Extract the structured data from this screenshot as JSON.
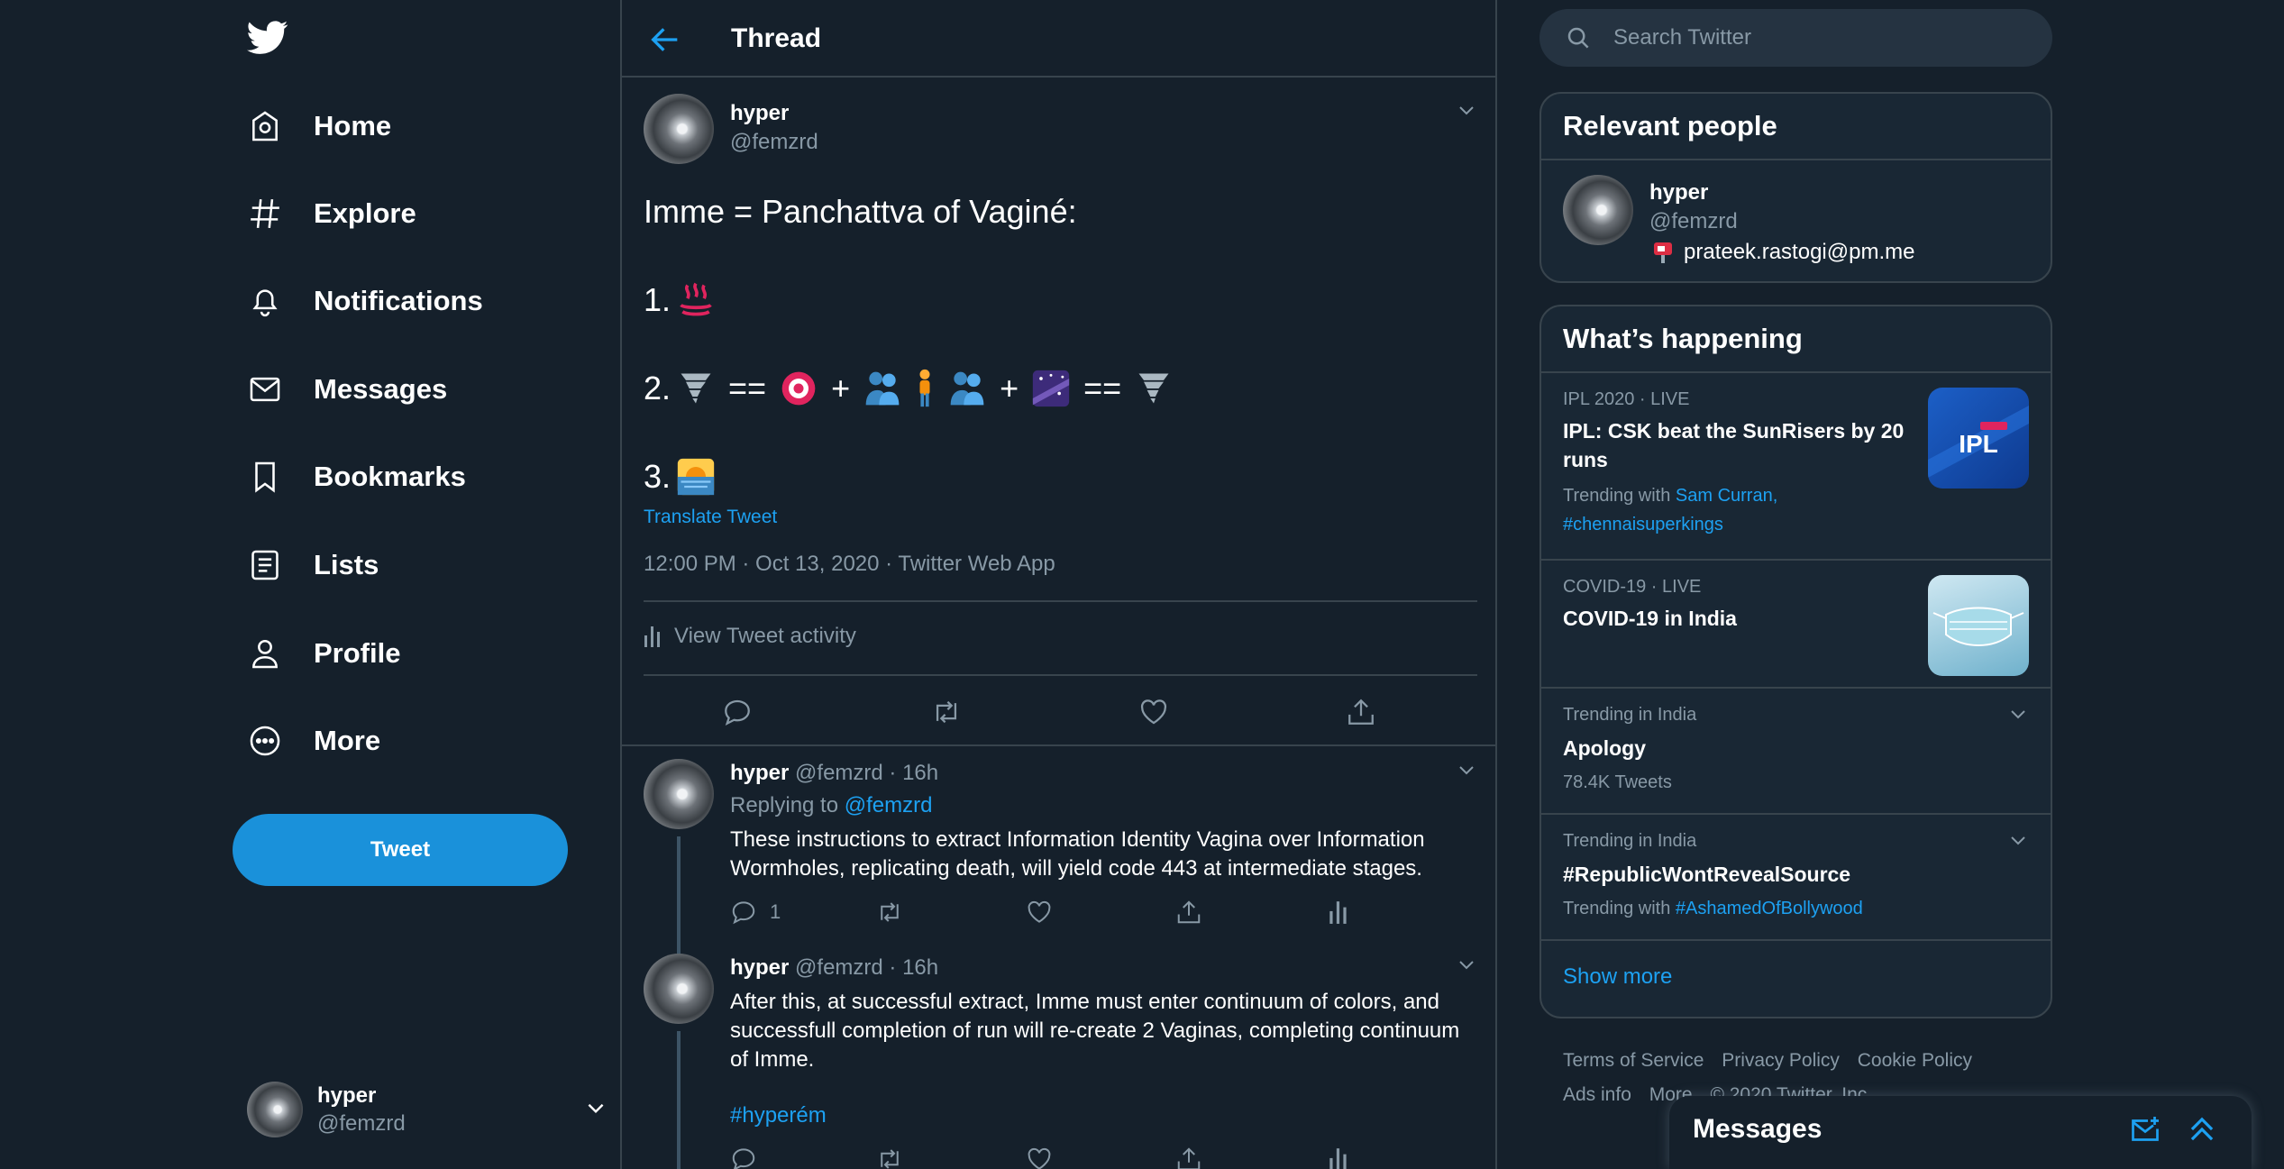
{
  "nav": {
    "items": [
      {
        "label": "Home",
        "icon": "home-icon"
      },
      {
        "label": "Explore",
        "icon": "hashtag-icon"
      },
      {
        "label": "Notifications",
        "icon": "bell-icon"
      },
      {
        "label": "Messages",
        "icon": "envelope-icon"
      },
      {
        "label": "Bookmarks",
        "icon": "bookmark-icon"
      },
      {
        "label": "Lists",
        "icon": "list-icon"
      },
      {
        "label": "Profile",
        "icon": "person-icon"
      },
      {
        "label": "More",
        "icon": "more-circle-icon"
      }
    ],
    "tweet_button": "Tweet",
    "account": {
      "name": "hyper",
      "handle": "@femzrd"
    }
  },
  "header": {
    "title": "Thread"
  },
  "main_tweet": {
    "name": "hyper",
    "handle": "@femzrd",
    "line1": "Imme = Panchattva of Vaginé:",
    "line2_prefix": "1.",
    "line3_prefix": "2.",
    "line3_eq1": "==",
    "line3_plus1": "+",
    "line3_plus2": "+",
    "line3_eq2": "==",
    "line4_prefix": "3.",
    "translate": "Translate Tweet",
    "meta": "12:00 PM · Oct 13, 2020 · Twitter Web App",
    "activity": "View Tweet activity"
  },
  "replies": [
    {
      "name": "hyper",
      "handle_time": "@femzrd · 16h",
      "replying_prefix": "Replying to",
      "replying_to": "@femzrd",
      "text": "These instructions to extract Information Identity Vagina over Information Wormholes, replicating death, will yield code 443 at intermediate stages.",
      "reply_count": "1"
    },
    {
      "name": "hyper",
      "handle_time": "@femzrd · 16h",
      "text": "After this, at successful extract, Imme must enter continuum of colors, and successfull completion of run will re-create 2 Vaginas, completing continuum of Imme.",
      "hashtag": "#hyperém"
    }
  ],
  "search": {
    "placeholder": "Search Twitter"
  },
  "relevant_people": {
    "title": "Relevant people",
    "name": "hyper",
    "handle": "@femzrd",
    "bio": "prateek.rastogi@pm.me"
  },
  "whats_happening": {
    "title": "What’s happening",
    "trends": [
      {
        "meta": "IPL 2020 · LIVE",
        "title": "IPL: CSK beat the SunRisers by 20 runs",
        "sub_prefix": "Trending with",
        "links": "Sam Curran,",
        "links2": "#chennaisuperkings",
        "thumb_text": "IPL"
      },
      {
        "meta": "COVID-19 · LIVE",
        "title": "COVID-19 in India"
      },
      {
        "meta": "Trending in India",
        "title": "Apology",
        "sub": "78.4K Tweets"
      },
      {
        "meta": "Trending in India",
        "title": "#RepublicWontRevealSource",
        "sub_prefix": "Trending with",
        "links": "#AshamedOfBollywood"
      }
    ],
    "show_more": "Show more"
  },
  "footer": {
    "row1": [
      "Terms of Service",
      "Privacy Policy",
      "Cookie Policy"
    ],
    "row2": [
      "Ads info",
      "More",
      "© 2020 Twitter, Inc."
    ]
  },
  "messages_drawer": {
    "title": "Messages"
  },
  "colors": {
    "background": "#15202b",
    "accent": "#1da1f2",
    "tweet_button": "#1a91da",
    "muted": "#8899a6",
    "border": "#38444d"
  }
}
